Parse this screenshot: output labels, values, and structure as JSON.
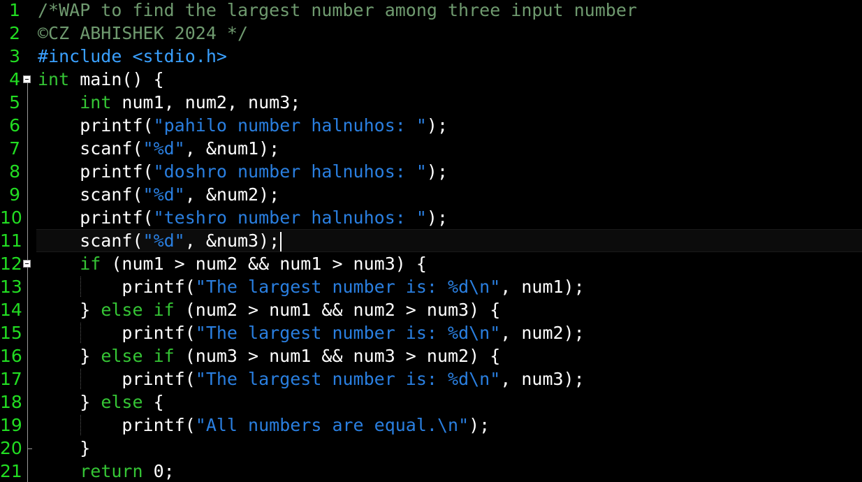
{
  "editor": {
    "colors": {
      "background": "#000000",
      "line_number": "#22dd22",
      "comment": "#6f9a6f",
      "keyword": "#35c535",
      "preprocessor": "#3aa0ff",
      "string": "#2a7fe0",
      "text": "#ffffff"
    },
    "current_line": 11,
    "lines": [
      {
        "n": "1",
        "tokens": [
          {
            "t": "comment",
            "v": "/*WAP to find the largest number among three input number"
          }
        ]
      },
      {
        "n": "2",
        "tokens": [
          {
            "t": "comment",
            "v": "©CZ ABHISHEK 2024 */"
          }
        ]
      },
      {
        "n": "3",
        "tokens": [
          {
            "t": "pre",
            "v": "#include <stdio.h>"
          }
        ]
      },
      {
        "n": "4",
        "tokens": [
          {
            "t": "kw",
            "v": "int"
          },
          {
            "t": "plain",
            "v": " main() {"
          }
        ]
      },
      {
        "n": "5",
        "tokens": [
          {
            "t": "plain",
            "v": "    "
          },
          {
            "t": "kw",
            "v": "int"
          },
          {
            "t": "plain",
            "v": " num1, num2, num3;"
          }
        ]
      },
      {
        "n": "6",
        "tokens": [
          {
            "t": "plain",
            "v": "    printf("
          },
          {
            "t": "str",
            "v": "\"pahilo number halnuhos: \""
          },
          {
            "t": "plain",
            "v": ");"
          }
        ]
      },
      {
        "n": "7",
        "tokens": [
          {
            "t": "plain",
            "v": "    scanf("
          },
          {
            "t": "str",
            "v": "\"%d\""
          },
          {
            "t": "plain",
            "v": ", &num1);"
          }
        ]
      },
      {
        "n": "8",
        "tokens": [
          {
            "t": "plain",
            "v": "    printf("
          },
          {
            "t": "str",
            "v": "\"doshro number halnuhos: \""
          },
          {
            "t": "plain",
            "v": ");"
          }
        ]
      },
      {
        "n": "9",
        "tokens": [
          {
            "t": "plain",
            "v": "    scanf("
          },
          {
            "t": "str",
            "v": "\"%d\""
          },
          {
            "t": "plain",
            "v": ", &num2);"
          }
        ]
      },
      {
        "n": "10",
        "tokens": [
          {
            "t": "plain",
            "v": "    printf("
          },
          {
            "t": "str",
            "v": "\"teshro number halnuhos: \""
          },
          {
            "t": "plain",
            "v": ");"
          }
        ]
      },
      {
        "n": "11",
        "tokens": [
          {
            "t": "plain",
            "v": "    scanf("
          },
          {
            "t": "str",
            "v": "\"%d\""
          },
          {
            "t": "plain",
            "v": ", &num3);"
          }
        ]
      },
      {
        "n": "12",
        "tokens": [
          {
            "t": "plain",
            "v": "    "
          },
          {
            "t": "kw",
            "v": "if"
          },
          {
            "t": "plain",
            "v": " (num1 > num2 && num1 > num3) {"
          }
        ]
      },
      {
        "n": "13",
        "tokens": [
          {
            "t": "plain",
            "v": "        printf("
          },
          {
            "t": "str",
            "v": "\"The largest number is: %d\\n\""
          },
          {
            "t": "plain",
            "v": ", num1);"
          }
        ]
      },
      {
        "n": "14",
        "tokens": [
          {
            "t": "plain",
            "v": "    } "
          },
          {
            "t": "kw",
            "v": "else if"
          },
          {
            "t": "plain",
            "v": " (num2 > num1 && num2 > num3) {"
          }
        ]
      },
      {
        "n": "15",
        "tokens": [
          {
            "t": "plain",
            "v": "        printf("
          },
          {
            "t": "str",
            "v": "\"The largest number is: %d\\n\""
          },
          {
            "t": "plain",
            "v": ", num2);"
          }
        ]
      },
      {
        "n": "16",
        "tokens": [
          {
            "t": "plain",
            "v": "    } "
          },
          {
            "t": "kw",
            "v": "else if"
          },
          {
            "t": "plain",
            "v": " (num3 > num1 && num3 > num2) {"
          }
        ]
      },
      {
        "n": "17",
        "tokens": [
          {
            "t": "plain",
            "v": "        printf("
          },
          {
            "t": "str",
            "v": "\"The largest number is: %d\\n\""
          },
          {
            "t": "plain",
            "v": ", num3);"
          }
        ]
      },
      {
        "n": "18",
        "tokens": [
          {
            "t": "plain",
            "v": "    } "
          },
          {
            "t": "kw",
            "v": "else"
          },
          {
            "t": "plain",
            "v": " {"
          }
        ]
      },
      {
        "n": "19",
        "tokens": [
          {
            "t": "plain",
            "v": "        printf("
          },
          {
            "t": "str",
            "v": "\"All numbers are equal.\\n\""
          },
          {
            "t": "plain",
            "v": ");"
          }
        ]
      },
      {
        "n": "20",
        "tokens": [
          {
            "t": "plain",
            "v": "    }"
          }
        ]
      },
      {
        "n": "21",
        "tokens": [
          {
            "t": "plain",
            "v": "    "
          },
          {
            "t": "kw",
            "v": "return"
          },
          {
            "t": "plain",
            "v": " 0;"
          }
        ]
      }
    ]
  }
}
